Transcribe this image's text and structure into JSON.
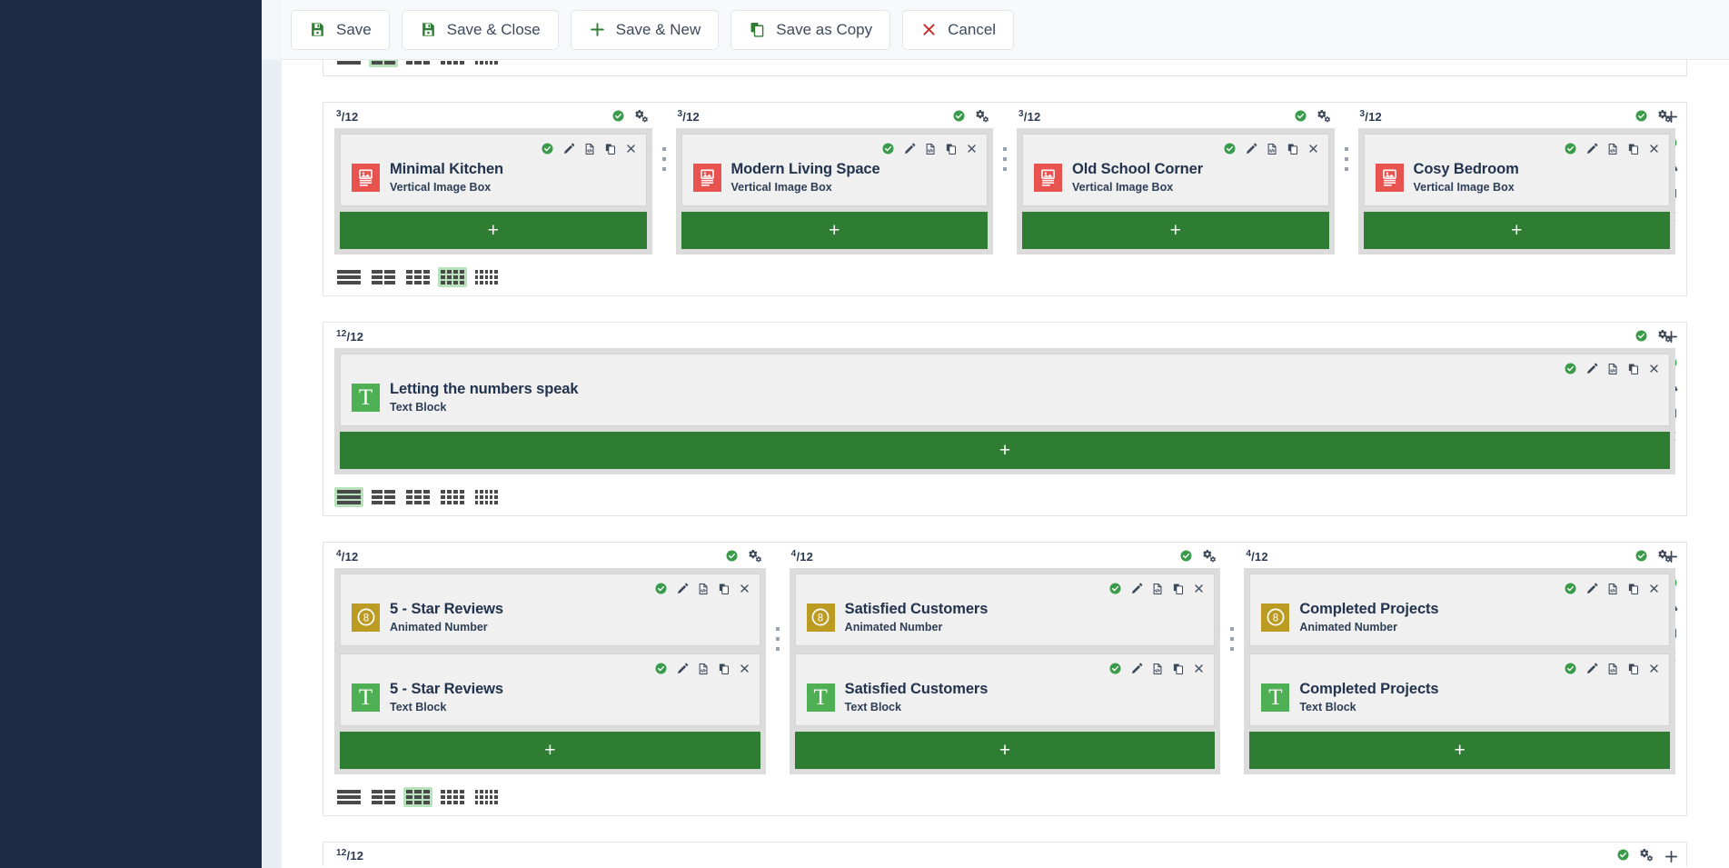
{
  "toolbar": {
    "buttons": [
      {
        "label": "Save",
        "icon": "save-icon"
      },
      {
        "label": "Save & Close",
        "icon": "save-icon"
      },
      {
        "label": "Save & New",
        "icon": "plus-icon"
      },
      {
        "label": "Save as Copy",
        "icon": "copy-icon"
      },
      {
        "label": "Cancel",
        "icon": "close-icon"
      }
    ]
  },
  "colors": {
    "green": "#2e7d32",
    "check_green": "#3a9c4a",
    "red_tile": "#e8534f",
    "green_tile": "#4eaf54",
    "gold_tile": "#bb9b22",
    "cancel_red": "#cc2b2b",
    "sidebar": "#1e2d45",
    "layout_active": "#b7e2bb"
  },
  "row_icons": {
    "check": "check-circle-icon",
    "settings": "settings-gears-icon",
    "plus": "plus-icon",
    "gear": "gear-icon",
    "copy": "copy-icon",
    "close": "close-icon"
  },
  "card_icons": {
    "check": "check-circle-icon",
    "edit": "pencil-icon",
    "code": "code-file-icon",
    "copy": "copy-icon",
    "close": "close-icon"
  },
  "layout_options": [
    1,
    2,
    3,
    4,
    5
  ],
  "rows": [
    {
      "id": "row-partial-top",
      "fraction_numerator": "",
      "partial": true,
      "active_layout": 2,
      "columns": []
    },
    {
      "id": "row-image-boxes",
      "active_layout": 4,
      "columns": [
        {
          "fraction_numerator": "3",
          "fraction_denominator": "12",
          "cards": [
            {
              "title": "Minimal Kitchen",
              "subtitle": "Vertical Image Box",
              "tile": "image"
            }
          ]
        },
        {
          "fraction_numerator": "3",
          "fraction_denominator": "12",
          "cards": [
            {
              "title": "Modern Living Space",
              "subtitle": "Vertical Image Box",
              "tile": "image"
            }
          ]
        },
        {
          "fraction_numerator": "3",
          "fraction_denominator": "12",
          "cards": [
            {
              "title": "Old School Corner",
              "subtitle": "Vertical Image Box",
              "tile": "image"
            }
          ]
        },
        {
          "fraction_numerator": "3",
          "fraction_denominator": "12",
          "cards": [
            {
              "title": "Cosy Bedroom",
              "subtitle": "Vertical Image Box",
              "tile": "image"
            }
          ]
        }
      ]
    },
    {
      "id": "row-text-block",
      "active_layout": 1,
      "columns": [
        {
          "fraction_numerator": "12",
          "fraction_denominator": "12",
          "cards": [
            {
              "title": "Letting the numbers speak",
              "subtitle": "Text Block",
              "tile": "text"
            }
          ]
        }
      ]
    },
    {
      "id": "row-stats",
      "active_layout": 3,
      "columns": [
        {
          "fraction_numerator": "4",
          "fraction_denominator": "12",
          "cards": [
            {
              "title": "5 - Star Reviews",
              "subtitle": "Animated Number",
              "tile": "number"
            },
            {
              "title": "5 - Star Reviews",
              "subtitle": "Text Block",
              "tile": "text"
            }
          ]
        },
        {
          "fraction_numerator": "4",
          "fraction_denominator": "12",
          "cards": [
            {
              "title": "Satisfied Customers",
              "subtitle": "Animated Number",
              "tile": "number"
            },
            {
              "title": "Satisfied Customers",
              "subtitle": "Text Block",
              "tile": "text"
            }
          ]
        },
        {
          "fraction_numerator": "4",
          "fraction_denominator": "12",
          "cards": [
            {
              "title": "Completed Projects",
              "subtitle": "Animated Number",
              "tile": "number"
            },
            {
              "title": "Completed Projects",
              "subtitle": "Text Block",
              "tile": "text"
            }
          ]
        }
      ]
    },
    {
      "id": "row-partial-bottom",
      "partial_bottom": true,
      "fraction_numerator": "12",
      "fraction_denominator": "12",
      "columns": []
    }
  ],
  "add_button_label": "+",
  "number_tile_glyph": "8",
  "text_tile_glyph": "T"
}
